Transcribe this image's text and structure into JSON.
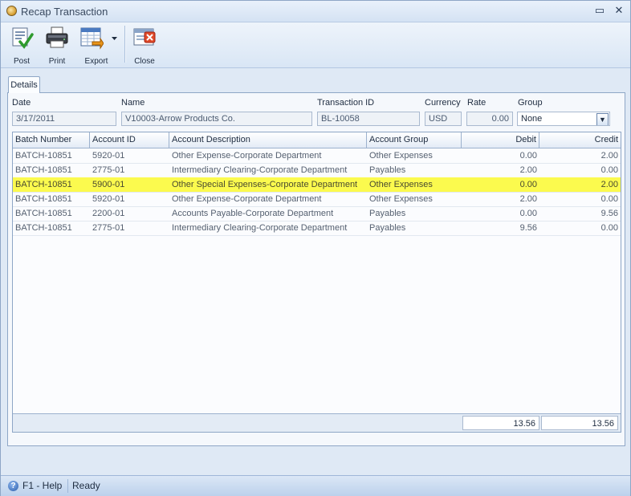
{
  "window": {
    "title": "Recap Transaction",
    "minimize": "▭",
    "close": "✕"
  },
  "toolbar": {
    "post": "Post",
    "print": "Print",
    "export": "Export",
    "close": "Close"
  },
  "tabs": {
    "details": "Details"
  },
  "form": {
    "date_label": "Date",
    "date_value": "3/17/2011",
    "name_label": "Name",
    "name_value": "V10003-Arrow Products Co.",
    "transaction_id_label": "Transaction ID",
    "transaction_id_value": "BL-10058",
    "currency_label": "Currency",
    "currency_value": "USD",
    "rate_label": "Rate",
    "rate_value": "0.00",
    "group_label": "Group",
    "group_value": "None"
  },
  "grid": {
    "columns": [
      "Batch Number",
      "Account ID",
      "Account Description",
      "Account Group",
      "Debit",
      "Credit"
    ],
    "rows": [
      [
        "BATCH-10851",
        "5920-01",
        "Other Expense-Corporate Department",
        "Other Expenses",
        "0.00",
        "2.00"
      ],
      [
        "BATCH-10851",
        "2775-01",
        "Intermediary Clearing-Corporate Department",
        "Payables",
        "2.00",
        "0.00"
      ],
      [
        "BATCH-10851",
        "5900-01",
        "Other Special Expenses-Corporate Department",
        "Other Expenses",
        "0.00",
        "2.00"
      ],
      [
        "BATCH-10851",
        "5920-01",
        "Other Expense-Corporate Department",
        "Other Expenses",
        "2.00",
        "0.00"
      ],
      [
        "BATCH-10851",
        "2200-01",
        "Accounts Payable-Corporate Department",
        "Payables",
        "0.00",
        "9.56"
      ],
      [
        "BATCH-10851",
        "2775-01",
        "Intermediary Clearing-Corporate Department",
        "Payables",
        "9.56",
        "0.00"
      ]
    ],
    "highlight_color": "#fbfa4e",
    "totals": {
      "debit": "13.56",
      "credit": "13.56"
    }
  },
  "status": {
    "help": "F1 - Help",
    "state": "Ready"
  }
}
